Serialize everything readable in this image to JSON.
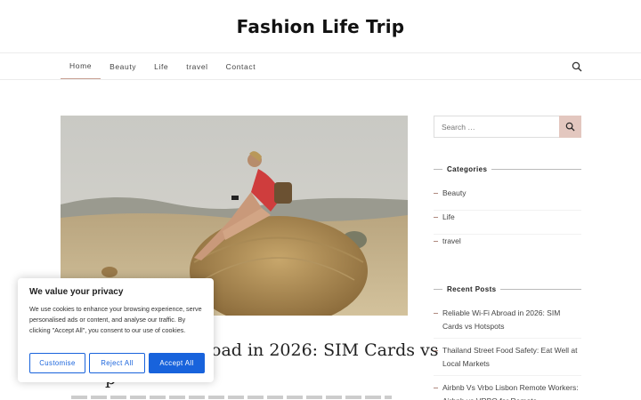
{
  "site": {
    "title": "Fashion Life Trip"
  },
  "nav": {
    "items": [
      {
        "label": "Home"
      },
      {
        "label": "Beauty"
      },
      {
        "label": "Life"
      },
      {
        "label": "travel"
      },
      {
        "label": "Contact"
      }
    ]
  },
  "post": {
    "title_visible_line1": "oad in 2026: SIM Cards vs",
    "title_visible_line2": "p"
  },
  "sidebar": {
    "search": {
      "placeholder": "Search …"
    },
    "categories_title": "Categories",
    "categories": [
      {
        "label": "Beauty"
      },
      {
        "label": "Life"
      },
      {
        "label": "travel"
      }
    ],
    "recent_title": "Recent Posts",
    "recent": [
      {
        "label": "Reliable Wi-Fi Abroad in 2026: SIM Cards vs Hotspots"
      },
      {
        "label": "Thailand Street Food Safety: Eat Well at Local Markets"
      },
      {
        "label": "Airbnb Vs Vrbo Lisbon Remote Workers: Airbnb vs VRBO for Remote"
      }
    ]
  },
  "cookie": {
    "title": "We value your privacy",
    "text": "We use cookies to enhance your browsing experience, serve personalised ads or content, and analyse our traffic. By clicking \"Accept All\", you consent to our use of cookies.",
    "customise": "Customise",
    "reject": "Reject All",
    "accept": "Accept All"
  },
  "colors": {
    "accent": "#c9a193",
    "search_button": "#e3c7bf",
    "cookie_blue": "#1863dc"
  },
  "icons": {
    "nav_search": "search-icon",
    "sidebar_search": "search-icon"
  }
}
